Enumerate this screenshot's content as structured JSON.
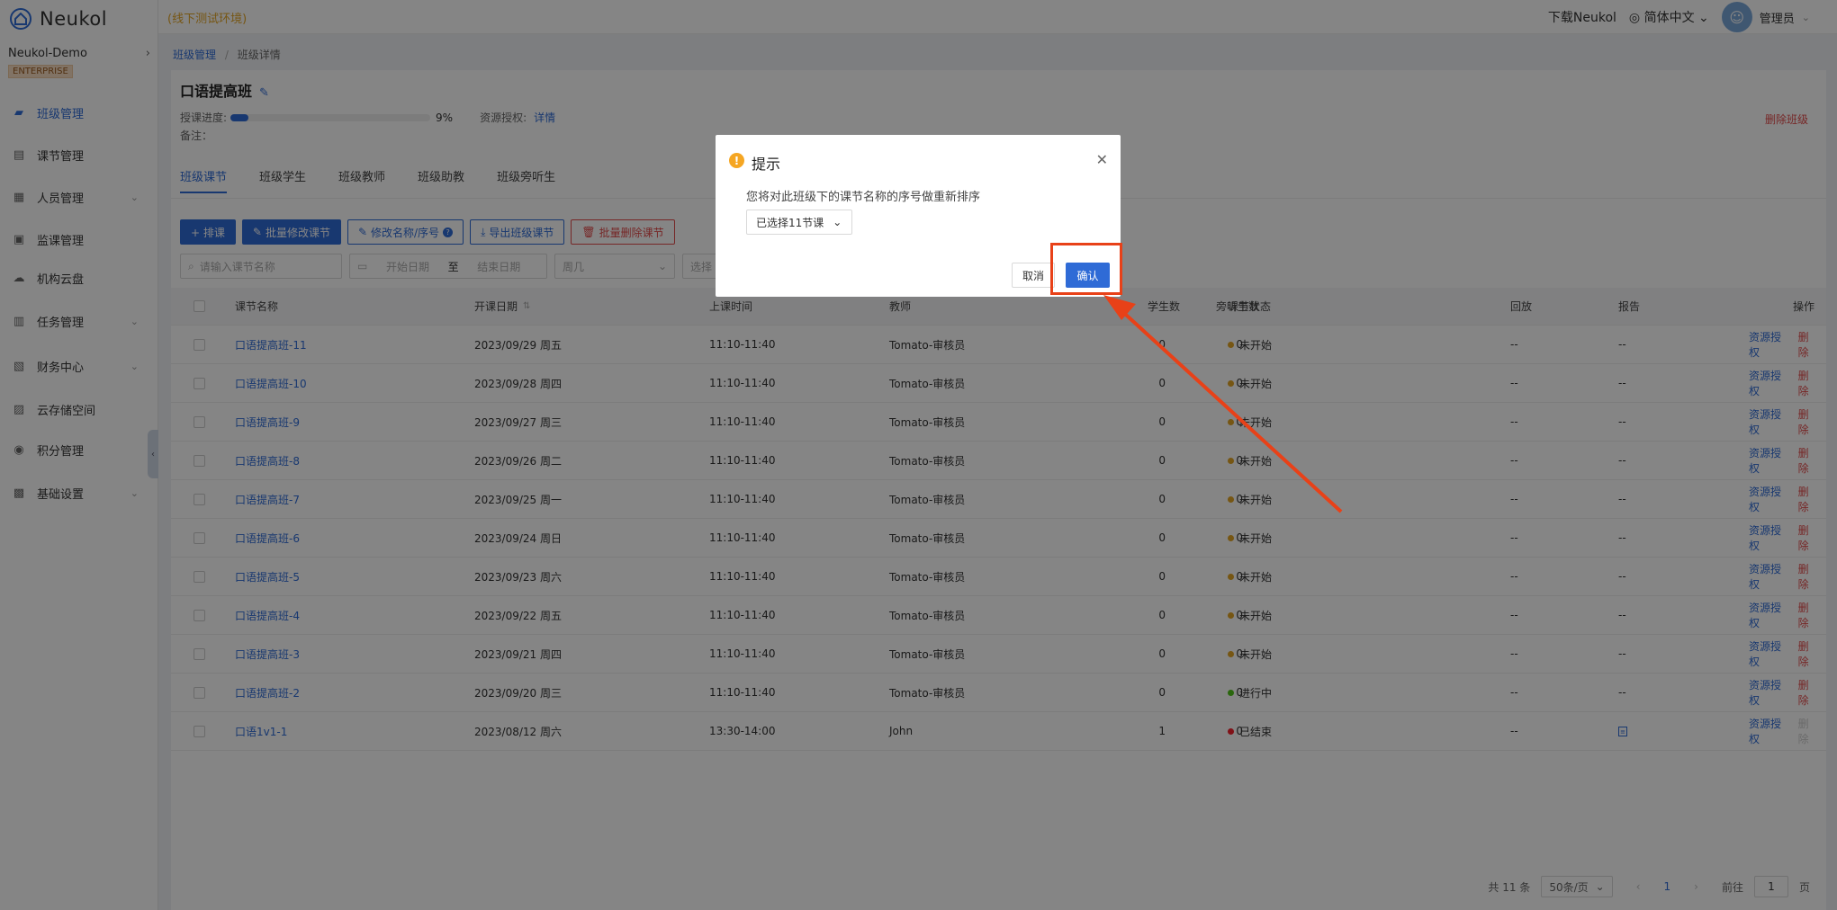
{
  "app": {
    "logo_text": "Neukol",
    "env_label": "(线下测试环境)"
  },
  "topbar": {
    "download": "下载Neukol",
    "language": "简体中文",
    "user": "管理员"
  },
  "sidebar": {
    "org_name": "Neukol-Demo",
    "edition": "ENTERPRISE",
    "items": [
      {
        "label": "班级管理",
        "icon": "class-icon",
        "active": true,
        "expandable": false
      },
      {
        "label": "课节管理",
        "icon": "lesson-icon",
        "active": false,
        "expandable": false
      },
      {
        "label": "人员管理",
        "icon": "people-icon",
        "active": false,
        "expandable": true
      },
      {
        "label": "监课管理",
        "icon": "monitor-icon",
        "active": false,
        "expandable": false
      },
      {
        "label": "机构云盘",
        "icon": "cloud-icon",
        "active": false,
        "expandable": false
      },
      {
        "label": "任务管理",
        "icon": "task-icon",
        "active": false,
        "expandable": true
      },
      {
        "label": "财务中心",
        "icon": "finance-icon",
        "active": false,
        "expandable": true
      },
      {
        "label": "云存储空间",
        "icon": "storage-icon",
        "active": false,
        "expandable": false
      },
      {
        "label": "积分管理",
        "icon": "points-icon",
        "active": false,
        "expandable": false
      },
      {
        "label": "基础设置",
        "icon": "settings-icon",
        "active": false,
        "expandable": true
      }
    ]
  },
  "breadcrumb": {
    "parent": "班级管理",
    "separator": "/",
    "current": "班级详情"
  },
  "class_info": {
    "title": "口语提高班",
    "progress_label": "授课进度:",
    "progress_value": 0.09,
    "progress_pct": "9%",
    "resource_label": "资源授权:",
    "resource_link": "详情",
    "note_label": "备注：",
    "delete_class": "删除班级"
  },
  "tabs": [
    "班级课节",
    "班级学生",
    "班级教师",
    "班级助教",
    "班级旁听生"
  ],
  "toolbar": {
    "schedule": "+ 排课",
    "batch_edit": "批量修改课节",
    "rename": "修改名称/序号",
    "export": "导出班级课节",
    "batch_delete": "批量删除课节"
  },
  "filters": {
    "search_placeholder": "请输入课节名称",
    "start_date": "开始日期",
    "to": "至",
    "end_date": "结束日期",
    "weekday": "周几",
    "select": "选择"
  },
  "table": {
    "headers": {
      "name": "课节名称",
      "date": "开课日期",
      "time": "上课时间",
      "teacher": "教师",
      "students": "学生数",
      "auditors": "旁听生数",
      "status": "课节状态",
      "replay": "回放",
      "report": "报告",
      "actions": "操作"
    },
    "action_auth": "资源授权",
    "action_delete": "删除",
    "rows": [
      {
        "name": "口语提高班-11",
        "date": "2023/09/29 周五",
        "time": "11:10-11:40",
        "teacher": "Tomato-审核员",
        "students": "0",
        "auditors": "0",
        "status": "未开始",
        "status_color": "#e3a526",
        "replay": "--",
        "report": "--",
        "delete_enabled": true
      },
      {
        "name": "口语提高班-10",
        "date": "2023/09/28 周四",
        "time": "11:10-11:40",
        "teacher": "Tomato-审核员",
        "students": "0",
        "auditors": "0",
        "status": "未开始",
        "status_color": "#e3a526",
        "replay": "--",
        "report": "--",
        "delete_enabled": true
      },
      {
        "name": "口语提高班-9",
        "date": "2023/09/27 周三",
        "time": "11:10-11:40",
        "teacher": "Tomato-审核员",
        "students": "0",
        "auditors": "0",
        "status": "未开始",
        "status_color": "#e3a526",
        "replay": "--",
        "report": "--",
        "delete_enabled": true
      },
      {
        "name": "口语提高班-8",
        "date": "2023/09/26 周二",
        "time": "11:10-11:40",
        "teacher": "Tomato-审核员",
        "students": "0",
        "auditors": "0",
        "status": "未开始",
        "status_color": "#e3a526",
        "replay": "--",
        "report": "--",
        "delete_enabled": true
      },
      {
        "name": "口语提高班-7",
        "date": "2023/09/25 周一",
        "time": "11:10-11:40",
        "teacher": "Tomato-审核员",
        "students": "0",
        "auditors": "0",
        "status": "未开始",
        "status_color": "#e3a526",
        "replay": "--",
        "report": "--",
        "delete_enabled": true
      },
      {
        "name": "口语提高班-6",
        "date": "2023/09/24 周日",
        "time": "11:10-11:40",
        "teacher": "Tomato-审核员",
        "students": "0",
        "auditors": "0",
        "status": "未开始",
        "status_color": "#e3a526",
        "replay": "--",
        "report": "--",
        "delete_enabled": true
      },
      {
        "name": "口语提高班-5",
        "date": "2023/09/23 周六",
        "time": "11:10-11:40",
        "teacher": "Tomato-审核员",
        "students": "0",
        "auditors": "0",
        "status": "未开始",
        "status_color": "#e3a526",
        "replay": "--",
        "report": "--",
        "delete_enabled": true
      },
      {
        "name": "口语提高班-4",
        "date": "2023/09/22 周五",
        "time": "11:10-11:40",
        "teacher": "Tomato-审核员",
        "students": "0",
        "auditors": "0",
        "status": "未开始",
        "status_color": "#e3a526",
        "replay": "--",
        "report": "--",
        "delete_enabled": true
      },
      {
        "name": "口语提高班-3",
        "date": "2023/09/21 周四",
        "time": "11:10-11:40",
        "teacher": "Tomato-审核员",
        "students": "0",
        "auditors": "0",
        "status": "未开始",
        "status_color": "#e3a526",
        "replay": "--",
        "report": "--",
        "delete_enabled": true
      },
      {
        "name": "口语提高班-2",
        "date": "2023/09/20 周三",
        "time": "11:10-11:40",
        "teacher": "Tomato-审核员",
        "students": "0",
        "auditors": "0",
        "status": "进行中",
        "status_color": "#52c41a",
        "replay": "--",
        "report": "--",
        "delete_enabled": true
      },
      {
        "name": "口语1v1-1",
        "date": "2023/08/12 周六",
        "time": "13:30-14:00",
        "teacher": "John",
        "students": "1",
        "auditors": "0",
        "status": "已结束",
        "status_color": "#f5222d",
        "replay": "--",
        "report": "report-icon",
        "delete_enabled": false
      }
    ]
  },
  "pagination": {
    "total": "共 11 条",
    "page_size": "50条/页",
    "prev": "‹",
    "current": "1",
    "next": "›",
    "goto_label": "前往",
    "goto_value": "1",
    "page_unit": "页"
  },
  "modal": {
    "title": "提示",
    "message": "您将对此班级下的课节名称的序号做重新排序",
    "select_value": "已选择11节课",
    "cancel": "取消",
    "confirm": "确认"
  },
  "colors": {
    "primary": "#2f6bd6",
    "danger": "#e34b4b",
    "warning": "#f5a623",
    "annotation": "#e84118",
    "env": "#e3a526"
  }
}
